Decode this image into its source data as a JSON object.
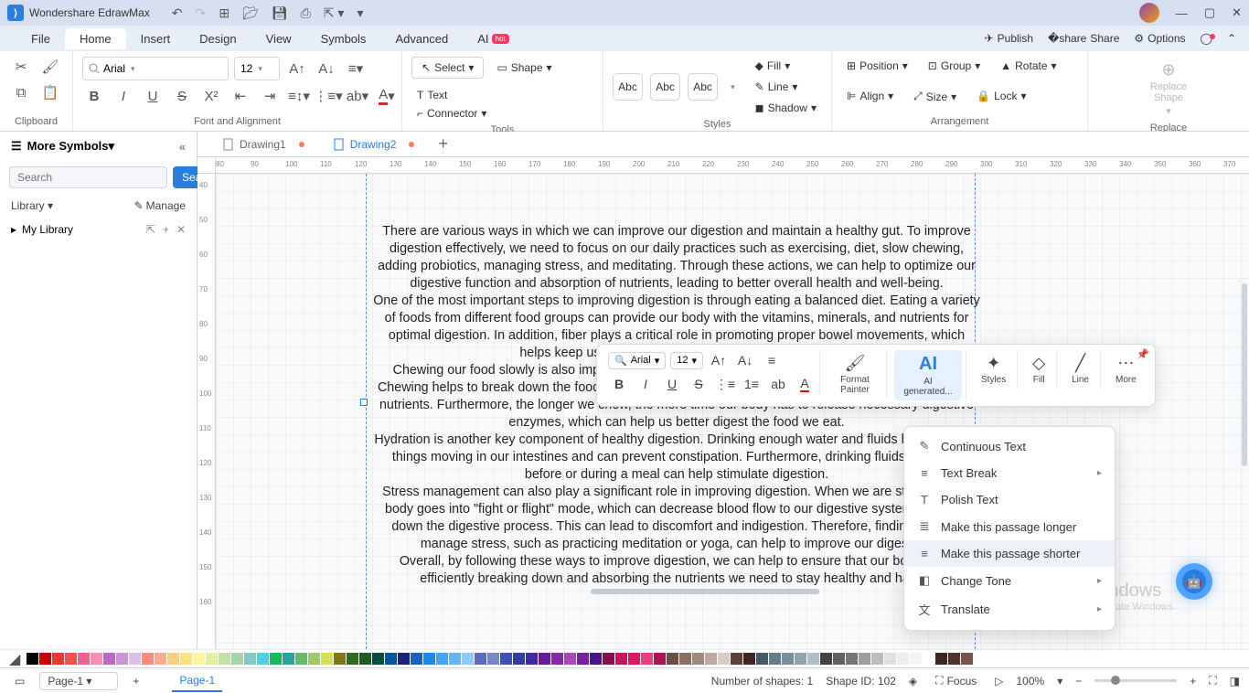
{
  "app": {
    "title": "Wondershare EdrawMax"
  },
  "menubar": {
    "items": [
      "File",
      "Home",
      "Insert",
      "Design",
      "View",
      "Symbols",
      "Advanced",
      "AI"
    ],
    "active": "Home",
    "hot_badge": "hot",
    "right": {
      "publish": "Publish",
      "share": "Share",
      "options": "Options"
    }
  },
  "ribbon": {
    "clipboard": {
      "label": "Clipboard"
    },
    "font": {
      "family": "Arial",
      "size": "12",
      "group_label": "Font and Alignment"
    },
    "tools": {
      "select": "Select",
      "shape": "Shape",
      "text": "Text",
      "connector": "Connector",
      "label": "Tools"
    },
    "styles": {
      "abc": "Abc",
      "label": "Styles",
      "fill": "Fill",
      "line": "Line",
      "shadow": "Shadow"
    },
    "arrange": {
      "position": "Position",
      "group": "Group",
      "rotate": "Rotate",
      "align": "Align",
      "size": "Size",
      "lock": "Lock",
      "label": "Arrangement"
    },
    "replace": {
      "btn": "Replace Shape",
      "label": "Replace"
    }
  },
  "sidebar": {
    "title": "More Symbols",
    "search_placeholder": "Search",
    "search_btn": "Search",
    "library": "Library",
    "manage": "Manage",
    "mylib": "My Library"
  },
  "tabs": [
    {
      "label": "Drawing1",
      "modified": true,
      "active": false
    },
    {
      "label": "Drawing2",
      "modified": true,
      "active": true
    }
  ],
  "ruler_h": [
    80,
    90,
    100,
    110,
    120,
    130,
    140,
    150,
    160,
    170,
    180,
    190,
    200,
    210,
    220,
    230,
    240,
    250,
    260,
    270,
    280,
    290,
    300,
    310,
    320,
    330,
    340,
    350,
    360,
    370
  ],
  "ruler_v": [
    40,
    50,
    60,
    70,
    80,
    90,
    100,
    110,
    120,
    130,
    140,
    150,
    160
  ],
  "text_content": {
    "p1": "There are various ways in which we can improve our digestion and maintain a healthy gut. To improve digestion effectively, we need to focus on our daily practices such as exercising, diet, slow chewing, adding probiotics, managing stress, and meditating. Through these actions, we can help to optimize our digestive function and absorption of nutrients, leading to better overall health and well-being.",
    "p2": "One of the most important steps to improving digestion is through eating a balanced diet. Eating a variety of foods from different food groups can provide our body with the vitamins, minerals, and nutrients for optimal digestion. In addition, fiber plays a critical role in promoting proper bowel movements, which helps keep us regular and promotes healthy digestion.",
    "p3": "Chewing our food slowly is also important because our saliva contains enzymes that aid digestion. Chewing helps to break down the food into smaller pieces, which makes it easier for our body to absorb nutrients. Furthermore, the longer we chew, the more time our body has to release necessary digestive enzymes, which can help us better digest the food we eat.",
    "p4": "Hydration is another key component of healthy digestion. Drinking enough water and fluids helps to keep things moving in our intestines and can prevent constipation. Furthermore, drinking fluids or liquids before or during a meal can help stimulate digestion.",
    "p5": "Stress management can also play a significant role in improving digestion. When we are stressed, our body goes into \"fight or flight\" mode, which can decrease blood flow to our digestive system and slow down the digestive process. This can lead to discomfort and indigestion. Therefore, finding ways to manage stress, such as practicing meditation or yoga, can help to improve our digestion.",
    "p6": "Overall, by following these ways to improve digestion, we can help to ensure that our bodies are efficiently breaking down and absorbing the nutrients we need to stay healthy and happy."
  },
  "float_tb": {
    "font": "Arial",
    "size": "12",
    "format_painter": "Format Painter",
    "ai": "AI generated...",
    "styles": "Styles",
    "fill": "Fill",
    "line": "Line",
    "more": "More"
  },
  "ctx_menu": {
    "continuous": "Continuous Text",
    "break": "Text Break",
    "polish": "Polish Text",
    "longer": "Make this passage longer",
    "shorter": "Make this passage shorter",
    "tone": "Change Tone",
    "translate": "Translate"
  },
  "swatches": [
    "#000000",
    "#cc0000",
    "#e53935",
    "#ef5350",
    "#f06292",
    "#f48fb1",
    "#ba68c8",
    "#ce93d8",
    "#e1bee7",
    "#ff8a80",
    "#ffab91",
    "#ffcc80",
    "#ffe082",
    "#fff59d",
    "#e6ee9c",
    "#c5e1a5",
    "#a5d6a7",
    "#80cbc4",
    "#4dd0e1",
    "#18b85f",
    "#26a69a",
    "#66bb6a",
    "#9ccc65",
    "#d4e157",
    "#827717",
    "#33691e",
    "#1b5e20",
    "#004d40",
    "#01579b",
    "#1a237e",
    "#1565c0",
    "#1e88e5",
    "#42a5f5",
    "#64b5f6",
    "#90caf9",
    "#5c6bc0",
    "#7986cb",
    "#3f51b5",
    "#303f9f",
    "#4527a0",
    "#6a1b9a",
    "#8e24aa",
    "#ab47bc",
    "#7b1fa2",
    "#4a148c",
    "#880e4f",
    "#c2185b",
    "#d81b60",
    "#ec407a",
    "#ad1457",
    "#6d4c41",
    "#8d6e63",
    "#a1887f",
    "#bcaaa4",
    "#d7ccc8",
    "#5d4037",
    "#3e2723",
    "#455a64",
    "#607d8b",
    "#78909c",
    "#90a4ae",
    "#b0bec5",
    "#424242",
    "#616161",
    "#757575",
    "#9e9e9e",
    "#bdbdbd",
    "#e0e0e0",
    "#eeeeee",
    "#f5f5f5",
    "#ffffff",
    "#3e2723",
    "#4e342e",
    "#795548"
  ],
  "statusbar": {
    "page_sel": "Page-1",
    "page_tab": "Page-1",
    "shapes": "Number of shapes: 1",
    "shapeid": "Shape ID: 102",
    "focus": "Focus",
    "zoom": "100%"
  },
  "watermark": {
    "line1": "Activate Windows",
    "line2": "Go to Settings to activate Windows."
  }
}
